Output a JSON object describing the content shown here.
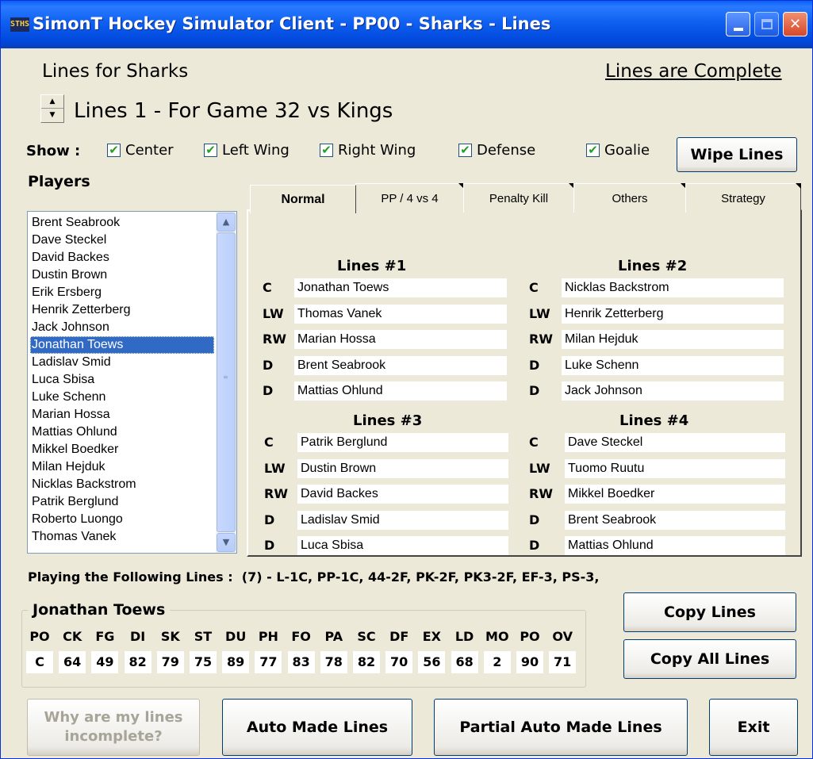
{
  "window": {
    "title": "SimonT Hockey Simulator Client - PP00 - Sharks - Lines",
    "icon_text": "STHS",
    "controls": [
      "minimize-icon",
      "maximize-icon",
      "close-icon"
    ]
  },
  "header": {
    "lines_for": "Lines for Sharks",
    "status": "Lines are Complete",
    "game_title": "Lines 1 - For Game 32 vs Kings"
  },
  "filters": {
    "label": "Show :",
    "items": [
      {
        "label": "Center",
        "checked": true
      },
      {
        "label": "Left Wing",
        "checked": true
      },
      {
        "label": "Right Wing",
        "checked": true
      },
      {
        "label": "Defense",
        "checked": true
      },
      {
        "label": "Goalie",
        "checked": true
      }
    ],
    "wipe_label": "Wipe Lines"
  },
  "players": {
    "label": "Players",
    "selected": "Jonathan Toews",
    "items": [
      "Brent Seabrook",
      "Dave Steckel",
      "David Backes",
      "Dustin Brown",
      "Erik Ersberg",
      "Henrik Zetterberg",
      "Jack Johnson",
      "Jonathan Toews",
      "Ladislav Smid",
      "Luca Sbisa",
      "Luke Schenn",
      "Marian Hossa",
      "Mattias Ohlund",
      "Mikkel Boedker",
      "Milan Hejduk",
      "Nicklas Backstrom",
      "Patrik Berglund",
      "Roberto Luongo",
      "Thomas Vanek"
    ]
  },
  "tabs": [
    {
      "label": "Normal",
      "active": true
    },
    {
      "label": "PP / 4 vs 4",
      "active": false
    },
    {
      "label": "Penalty Kill",
      "active": false
    },
    {
      "label": "Others",
      "active": false
    },
    {
      "label": "Strategy",
      "active": false
    }
  ],
  "lines": [
    {
      "title": "Lines #1",
      "slots": [
        {
          "pos": "C",
          "player": "Jonathan Toews"
        },
        {
          "pos": "LW",
          "player": "Thomas Vanek"
        },
        {
          "pos": "RW",
          "player": "Marian Hossa"
        },
        {
          "pos": "D",
          "player": "Brent Seabrook"
        },
        {
          "pos": "D",
          "player": "Mattias Ohlund"
        }
      ]
    },
    {
      "title": "Lines #2",
      "slots": [
        {
          "pos": "C",
          "player": "Nicklas Backstrom"
        },
        {
          "pos": "LW",
          "player": "Henrik Zetterberg"
        },
        {
          "pos": "RW",
          "player": "Milan Hejduk"
        },
        {
          "pos": "D",
          "player": "Luke Schenn"
        },
        {
          "pos": "D",
          "player": "Jack Johnson"
        }
      ]
    },
    {
      "title": "Lines #3",
      "slots": [
        {
          "pos": "C",
          "player": "Patrik Berglund"
        },
        {
          "pos": "LW",
          "player": "Dustin Brown"
        },
        {
          "pos": "RW",
          "player": "David Backes"
        },
        {
          "pos": "D",
          "player": "Ladislav Smid"
        },
        {
          "pos": "D",
          "player": "Luca Sbisa"
        }
      ]
    },
    {
      "title": "Lines #4",
      "slots": [
        {
          "pos": "C",
          "player": "Dave Steckel"
        },
        {
          "pos": "LW",
          "player": "Tuomo Ruutu"
        },
        {
          "pos": "RW",
          "player": "Mikkel Boedker"
        },
        {
          "pos": "D",
          "player": "Brent Seabrook"
        },
        {
          "pos": "D",
          "player": "Mattias Ohlund"
        }
      ]
    }
  ],
  "playing": {
    "label": "Playing the Following Lines :",
    "value": "(7) - L-1C, PP-1C, 44-2F, PK-2F, PK3-2F, EF-3, PS-3,"
  },
  "player_stats": {
    "name": "Jonathan Toews",
    "headers": [
      "PO",
      "CK",
      "FG",
      "DI",
      "SK",
      "ST",
      "DU",
      "PH",
      "FO",
      "PA",
      "SC",
      "DF",
      "EX",
      "LD",
      "MO",
      "PO",
      "OV"
    ],
    "values": [
      "C",
      "64",
      "49",
      "82",
      "79",
      "75",
      "89",
      "77",
      "83",
      "78",
      "82",
      "70",
      "56",
      "68",
      "2",
      "90",
      "71"
    ]
  },
  "buttons": {
    "copy_lines": "Copy Lines",
    "copy_all_lines": "Copy All Lines",
    "why_incomplete": "Why are my lines incomplete?",
    "auto": "Auto Made Lines",
    "partial_auto": "Partial Auto Made Lines",
    "exit": "Exit"
  },
  "colors": {
    "window_bg": "#ece9d8",
    "titlebar": "#0054e3",
    "selection": "#316ac5"
  }
}
